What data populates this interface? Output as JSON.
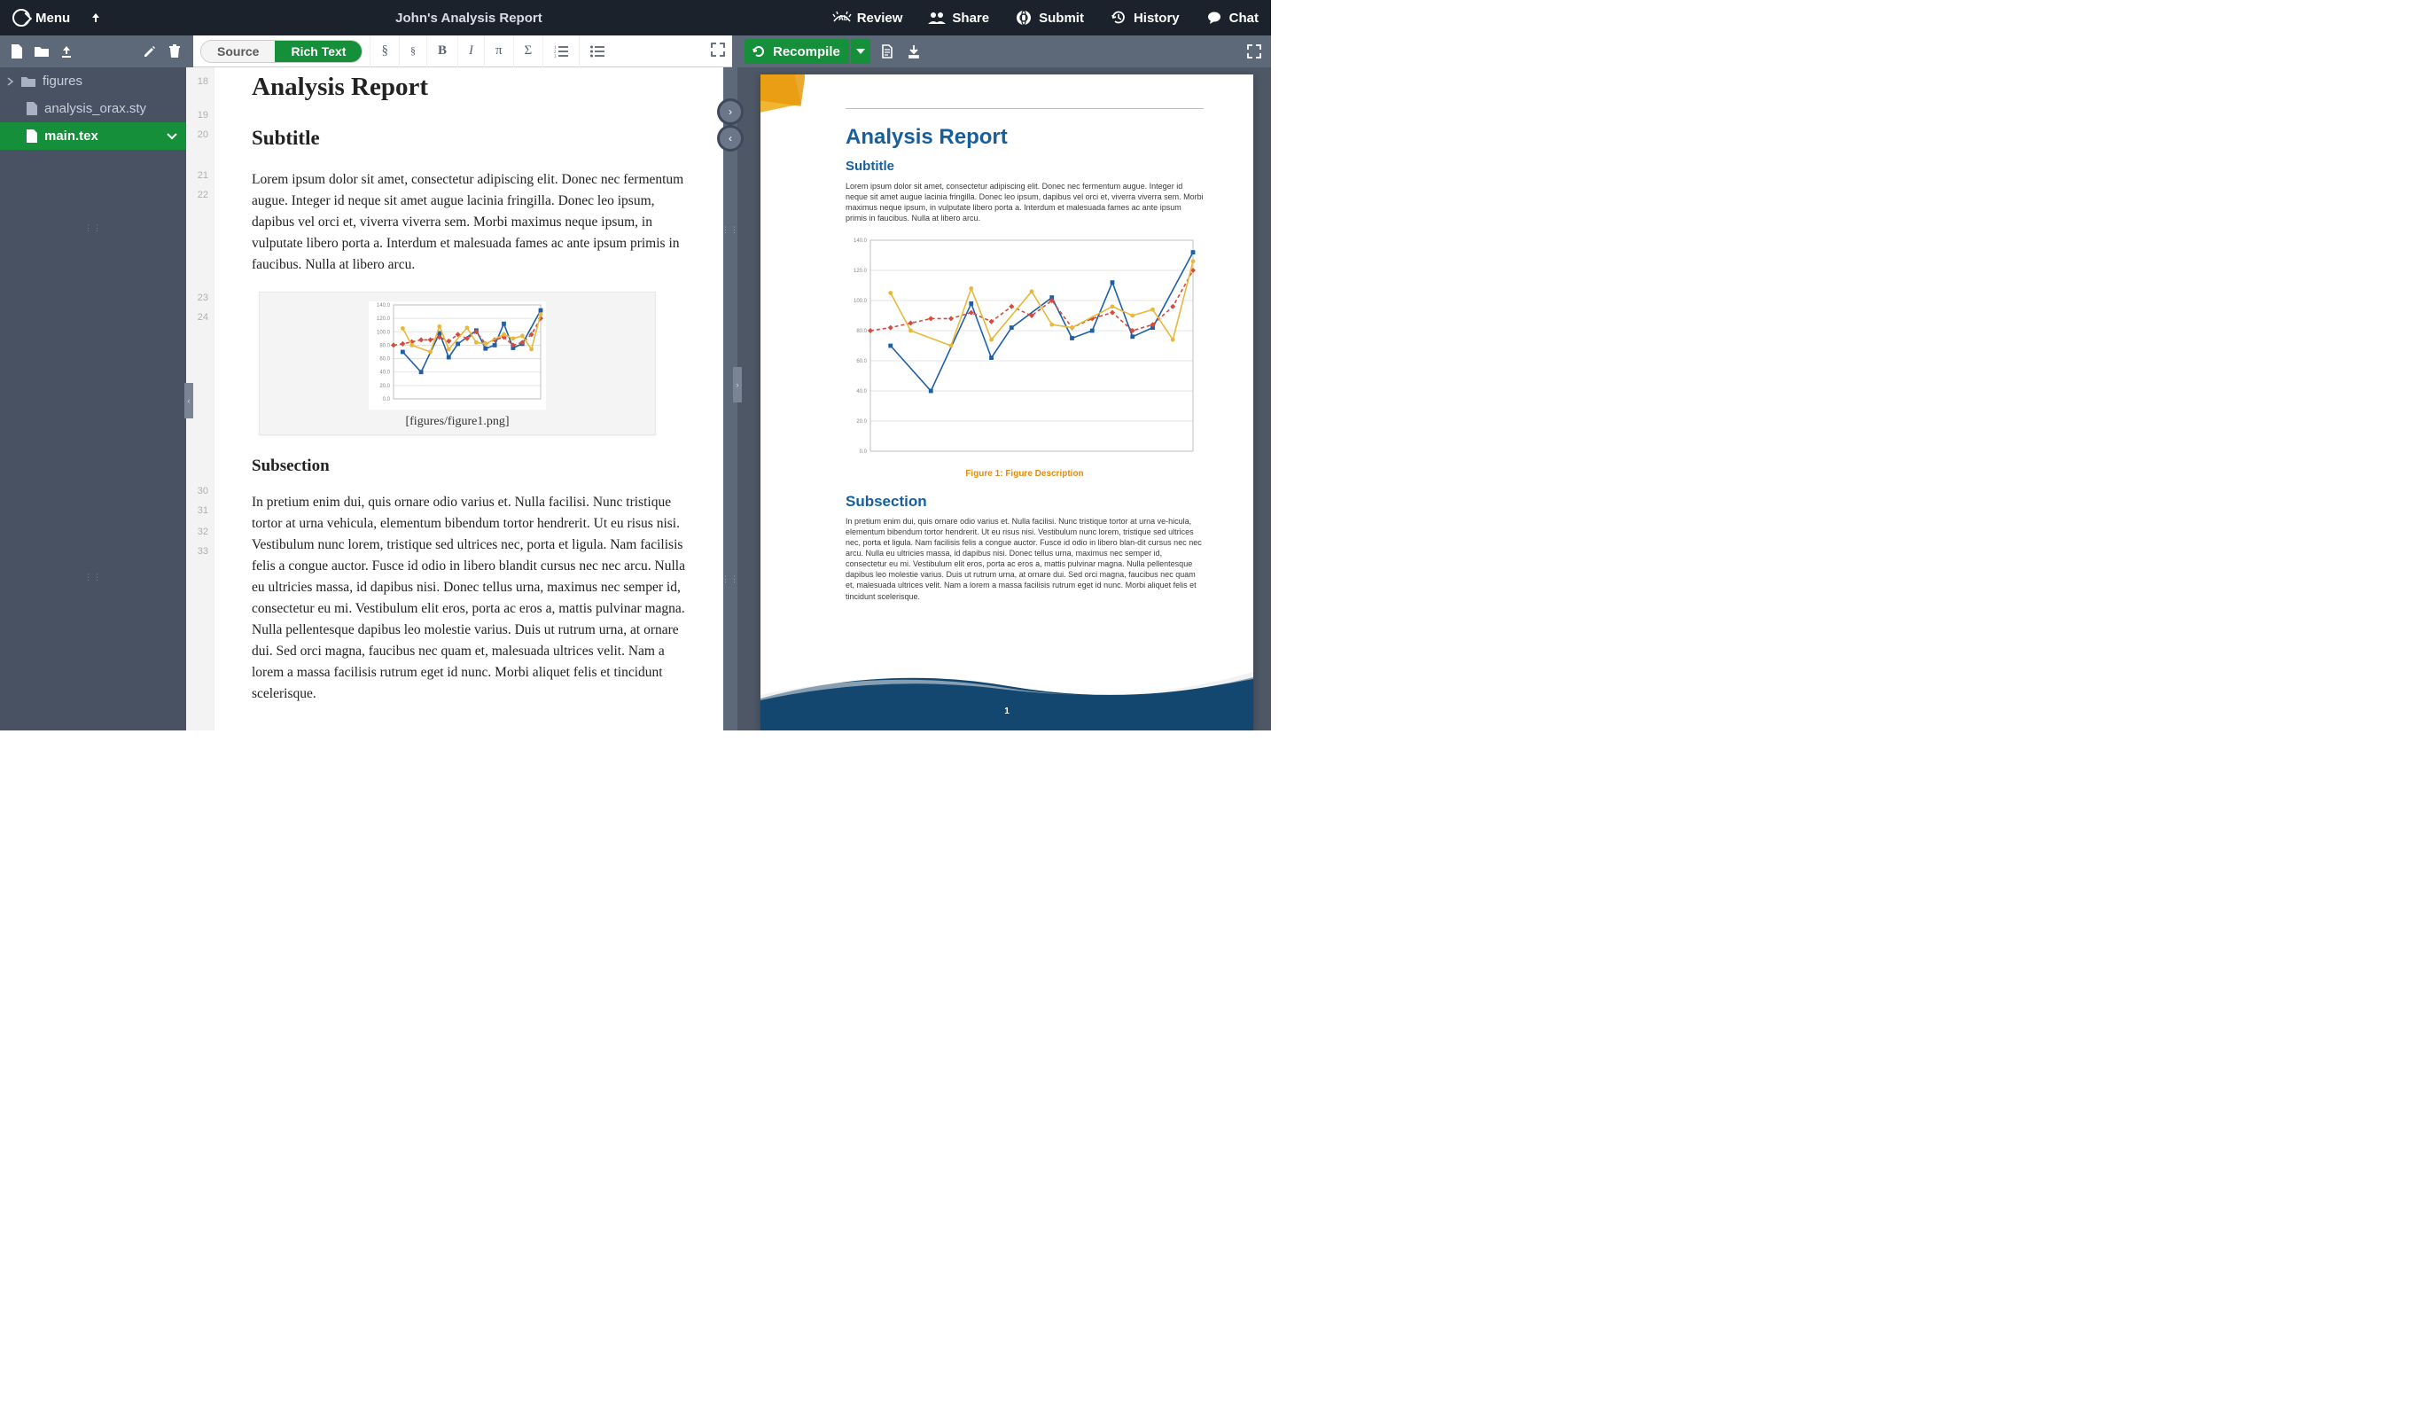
{
  "header": {
    "menu_label": "Menu",
    "title": "John's Analysis Report",
    "review_label": "Review",
    "share_label": "Share",
    "submit_label": "Submit",
    "history_label": "History",
    "chat_label": "Chat"
  },
  "toolbar": {
    "source_label": "Source",
    "richtext_label": "Rich Text",
    "recompile_label": "Recompile"
  },
  "files": {
    "folder_figures": "figures",
    "file_style": "analysis_orax.sty",
    "file_main": "main.tex"
  },
  "gutter": [
    "18",
    "19",
    "20",
    "21",
    "22",
    "23",
    "24",
    "30",
    "31",
    "32",
    "33"
  ],
  "doc": {
    "title": "Analysis Report",
    "subtitle": "Subtitle",
    "para1": "Lorem ipsum dolor sit amet, consectetur adipiscing elit. Donec nec fermentum augue. Integer id neque sit amet augue lacinia fringilla. Donec leo ipsum, dapibus vel orci et, viverra viverra sem. Morbi maximus neque ipsum, in vulputate libero porta a. Interdum et malesuada fames ac ante ipsum primis in faucibus. Nulla at libero arcu.",
    "figure_caption": "[figures/figure1.png]",
    "subsection": "Subsection",
    "para2": "In pretium enim dui, quis ornare odio varius et. Nulla facilisi. Nunc tristique tortor at urna vehicula, elementum bibendum tortor hendrerit. Ut eu risus nisi. Vestibulum nunc lorem, tristique sed ultrices nec, porta et ligula. Nam facilisis felis a congue auctor. Fusce id odio in libero blandit cursus nec nec arcu. Nulla eu ultricies massa, id dapibus nisi. Donec tellus urna, maximus nec semper id, consectetur eu mi. Vestibulum elit eros, porta ac eros a, mattis pulvinar magna. Nulla pellentesque dapibus leo molestie varius. Duis ut rutrum urna, at ornare dui. Sed orci magna, faucibus nec quam et, malesuada ultrices velit. Nam a lorem a massa facilisis rutrum eget id nunc. Morbi aliquet felis et tincidunt scelerisque."
  },
  "preview": {
    "title": "Analysis Report",
    "subtitle": "Subtitle",
    "para1": "Lorem ipsum dolor sit amet, consectetur adipiscing elit. Donec nec fermentum augue. Integer id neque sit amet augue lacinia fringilla. Donec leo ipsum, dapibus vel orci et, viverra viverra sem. Morbi maximus neque ipsum, in vulputate libero porta a. Interdum et malesuada fames ac ante ipsum primis in faucibus. Nulla at libero arcu.",
    "figure_caption": "Figure 1: Figure Description",
    "subsection": "Subsection",
    "para2": "In pretium enim dui, quis ornare odio varius et.  Nulla facilisi.  Nunc tristique tortor at urna ve-hicula, elementum bibendum tortor hendrerit. Ut eu risus nisi. Vestibulum nunc lorem, tristique sed ultrices nec, porta et ligula. Nam facilisis felis a congue auctor. Fusce id odio in libero blan-dit cursus nec nec arcu. Nulla eu ultricies massa, id dapibus nisi. Donec tellus urna, maximus nec semper id, consectetur eu mi. Vestibulum elit eros, porta ac eros a, mattis pulvinar magna. Nulla pellentesque dapibus leo molestie varius. Duis ut rutrum urna, at ornare dui. Sed orci magna, faucibus nec quam et, malesuada ultrices velit. Nam a lorem a massa facilisis rutrum eget id nunc. Morbi aliquet felis et tincidunt scelerisque.",
    "page_num": "1"
  },
  "chart_data": {
    "type": "line",
    "x": [
      1,
      2,
      3,
      4,
      5,
      6,
      7,
      8,
      9,
      10,
      11,
      12,
      13,
      14,
      15,
      16,
      17
    ],
    "series": [
      {
        "name": "blue",
        "color": "#1e5fa8",
        "style": "solid-square",
        "values": [
          null,
          70,
          null,
          40,
          null,
          98,
          62,
          82,
          null,
          102,
          75,
          80,
          112,
          76,
          82,
          null,
          132
        ]
      },
      {
        "name": "red",
        "color": "#d64b3d",
        "style": "dashed-diamond",
        "values": [
          80,
          82,
          85,
          88,
          88,
          92,
          86,
          96,
          90,
          100,
          82,
          88,
          92,
          80,
          84,
          96,
          120
        ]
      },
      {
        "name": "yellow",
        "color": "#e8b838",
        "style": "solid-circle",
        "values": [
          null,
          105,
          80,
          null,
          70,
          108,
          74,
          null,
          106,
          84,
          82,
          null,
          96,
          90,
          94,
          74,
          126
        ]
      }
    ],
    "ylabel_ticks": [
      "0.0",
      "20.0",
      "40.0",
      "60.0",
      "80.0",
      "100.0",
      "120.0",
      "140.0"
    ],
    "ylim": [
      0,
      140
    ]
  }
}
